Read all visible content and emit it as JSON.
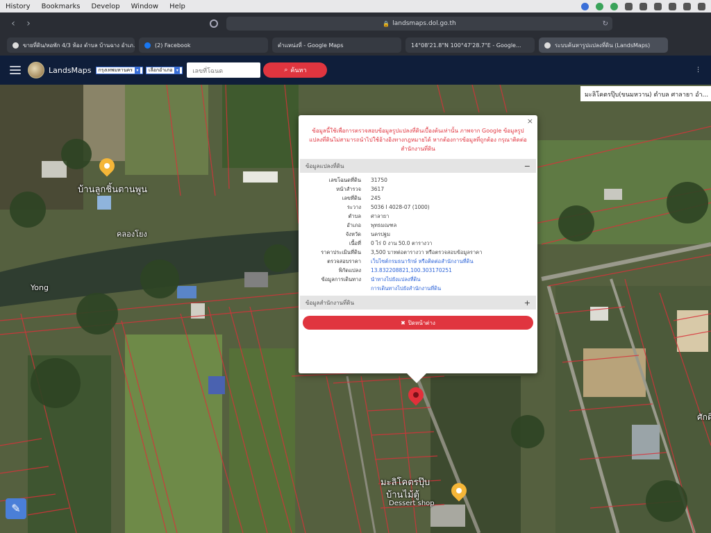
{
  "menubar": {
    "items": [
      "History",
      "Bookmarks",
      "Develop",
      "Window",
      "Help"
    ]
  },
  "browser": {
    "url": "landsmaps.dol.go.th",
    "tabs": [
      {
        "label": "ขายที่ดิน/หอพัก 4/3 ห้อง ตำบล บ้านฉาง อำเภ...",
        "icon": "home-icon"
      },
      {
        "label": "(2) Facebook",
        "icon": "facebook-icon"
      },
      {
        "label": "ตำแหน่งที่ - Google Maps",
        "icon": "maps-icon"
      },
      {
        "label": "14°08'21.8\"N 100°47'28.7\"E - Google...",
        "icon": "maps-icon"
      },
      {
        "label": "ระบบค้นหารูปแปลงที่ดิน (LandsMaps)",
        "icon": "landsmaps-icon"
      }
    ]
  },
  "app": {
    "brand": "LandsMaps",
    "province_select": "กรุงเทพมหานคร",
    "district_select": "เลือกอำเภอ",
    "search_placeholder": "เลขที่โฉนด",
    "search_button": "ค้นหา"
  },
  "map": {
    "labels": {
      "village": "บ้านลูกชิ้นตานพูน",
      "canal": "คลองโยง",
      "canal_en": "Yong",
      "cafe_th": "มะลิโคตรปุ๊บ",
      "cafe_th2": "บ้านไม้ตู้",
      "cafe_en": "Dessert shop",
      "edge_right": "ศักดิ์",
      "top_tooltip": "มะลิโคตรปุ๊บ(ขนมหวาน) ตำบล ศาลายา อำ..."
    }
  },
  "popup": {
    "notice": "ข้อมูลนี้ใช้เพื่อการตรวจสอบข้อมูลรูปแปลงที่ดินเบื้องต้นเท่านั้น ภาพจาก Google ข้อมูลรูปแปลงที่ดินไม่สามารถนำไปใช้อ้างอิงทางกฎหมายได้ หากต้องการข้อมูลที่ถูกต้อง กรุณาติดต่อสำนักงานที่ดิน",
    "section1": "ข้อมูลแปลงที่ดิน",
    "section2": "ข้อมูลสำนักงานที่ดิน",
    "toggle_open": "−",
    "toggle_closed": "+",
    "rows": [
      {
        "k": "เลขโฉนดที่ดิน",
        "v": "31750",
        "link": false
      },
      {
        "k": "หน้าสำรวจ",
        "v": "3617",
        "link": false
      },
      {
        "k": "เลขที่ดิน",
        "v": "245",
        "link": false
      },
      {
        "k": "ระวาง",
        "v": "5036 I 4028-07 (1000)",
        "link": false
      },
      {
        "k": "ตำบล",
        "v": "ศาลายา",
        "link": false
      },
      {
        "k": "อำเภอ",
        "v": "พุทธมณฑล",
        "link": false
      },
      {
        "k": "จังหวัด",
        "v": "นครปฐม",
        "link": false
      },
      {
        "k": "เนื้อที่",
        "v": "0 ไร่ 0 งาน 50.0 ตารางวา",
        "link": false
      },
      {
        "k": "ราคาประเมินที่ดิน",
        "v": "3,500 บาทต่อตารางวา หรือตรวจสอบข้อมูลราคา",
        "link": false
      },
      {
        "k": "ตรวจสอบราคา",
        "v": "เว็บไซต์กรมธนารักษ์ หรือติดต่อสำนักงานที่ดิน",
        "link": true
      },
      {
        "k": "พิกัดแปลง",
        "v": "13.832208821,100.303170251",
        "link": true
      },
      {
        "k": "ข้อมูลการเดินทาง",
        "v": "นำทางไปยังแปลงที่ดิน",
        "link": true
      },
      {
        "k": "",
        "v": "การเดินทางไปยังสำนักงานที่ดิน",
        "link": true
      }
    ],
    "cancel": "ปิดหน้าต่าง"
  }
}
